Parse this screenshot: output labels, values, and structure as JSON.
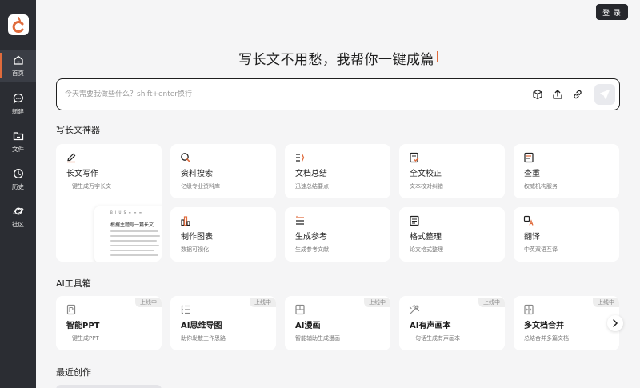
{
  "sidebar": {
    "items": [
      {
        "label": "首页",
        "icon": "home-icon",
        "active": true
      },
      {
        "label": "新建",
        "icon": "new-chat-icon"
      },
      {
        "label": "文件",
        "icon": "folder-icon"
      },
      {
        "label": "历史",
        "icon": "clock-icon"
      },
      {
        "label": "社区",
        "icon": "planet-icon"
      }
    ]
  },
  "header": {
    "login_label": "登 录"
  },
  "hero": {
    "title": "写长文不用愁，我帮你一键成篇"
  },
  "prompt": {
    "placeholder": "今天需要我做些什么？shift+enter换行"
  },
  "sections": {
    "writing_tools": "写长文神器",
    "ai_tools": "AI工具箱",
    "recent": "最近创作"
  },
  "writing_tools": [
    {
      "title": "长文写作",
      "desc": "一键生成万字长文",
      "icon": "pen-icon"
    },
    {
      "title": "资料搜索",
      "desc": "亿级专业资料库",
      "icon": "search-icon"
    },
    {
      "title": "文档总结",
      "desc": "迅速总结要点",
      "icon": "list-summary-icon"
    },
    {
      "title": "全文校正",
      "desc": "文本校对纠错",
      "icon": "proofread-icon"
    },
    {
      "title": "查重",
      "desc": "权威机构服务",
      "icon": "duplicate-check-icon"
    },
    {
      "title": "制作图表",
      "desc": "数据可视化",
      "icon": "bar-chart-icon"
    },
    {
      "title": "生成参考",
      "desc": "生成参考文献",
      "icon": "reference-icon"
    },
    {
      "title": "格式整理",
      "desc": "论文格式整理",
      "icon": "format-icon"
    },
    {
      "title": "翻译",
      "desc": "中英双语互译",
      "icon": "translate-icon"
    }
  ],
  "preview": {
    "toolbar": "B I U S ≡ ≡ ≡",
    "title": "根据主题写一篇长文..."
  },
  "ai_tools": [
    {
      "title": "智能PPT",
      "desc": "一键生成PPT",
      "badge": "上线中",
      "icon": "ppt-icon"
    },
    {
      "title": "AI思维导图",
      "desc": "助你发散工作思路",
      "badge": "上线中",
      "icon": "mindmap-icon"
    },
    {
      "title": "AI漫画",
      "desc": "智能辅助生成漫画",
      "badge": "上线中",
      "icon": "comic-icon"
    },
    {
      "title": "AI有声画本",
      "desc": "一句话生成有声画本",
      "badge": "上线中",
      "icon": "audio-book-icon"
    },
    {
      "title": "多文档合并",
      "desc": "总结合并多篇文档",
      "badge": "上线中",
      "icon": "merge-docs-icon"
    }
  ],
  "colors": {
    "accent": "#e06b3c",
    "sidebar": "#2b2d33",
    "background": "#f5f5f6"
  }
}
